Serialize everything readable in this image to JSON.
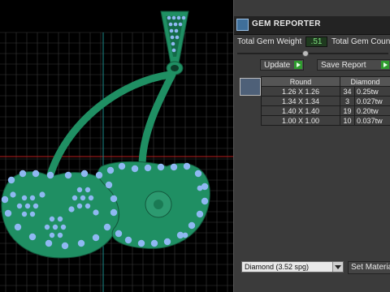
{
  "reporter": {
    "title": "GEM REPORTER",
    "total_weight_label": "Total Gem Weight",
    "total_weight_value": ".51",
    "total_count_label": "Total Gem Coun",
    "update_label": "Update",
    "save_report_label": "Save Report"
  },
  "table": {
    "columns": [
      "Round",
      "Diamond"
    ],
    "rows": [
      {
        "size": "1.26 X 1.26",
        "count": "34",
        "weight": "0.25tw"
      },
      {
        "size": "1.34 X 1.34",
        "count": "3",
        "weight": "0.027tw"
      },
      {
        "size": "1.40 X 1.40",
        "count": "19",
        "weight": "0.20tw"
      },
      {
        "size": "1.00 X 1.00",
        "count": "10",
        "weight": "0.037tw"
      }
    ]
  },
  "material": {
    "selected": "Diamond    (3.52 spg)",
    "set_material_label": "Set Materia"
  },
  "colors": {
    "metal": "#1f8f63",
    "gem": "#8fb8f2",
    "grid": "#3a3a3a",
    "axis_red": "#b81e1e",
    "axis_cyan": "#1c8a8a"
  }
}
